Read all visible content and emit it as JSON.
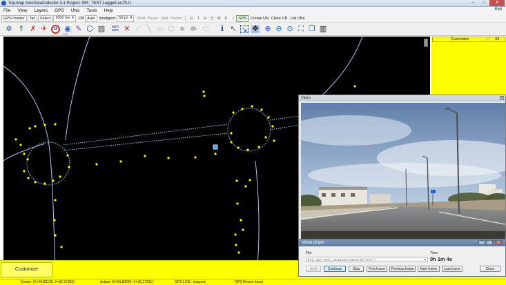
{
  "window": {
    "title": "Top-Map GeoDataCollector 3.1   Project: ISR_TEST  Logged as:PLU",
    "minimize": "–",
    "maximize": "□",
    "close": "✕"
  },
  "menu": {
    "items": [
      "File",
      "View",
      "Layers",
      "GPS",
      "UNs",
      "Tools",
      "Help"
    ],
    "exit_label": "Exit"
  },
  "toolbar": {
    "gps_pointer": "GPS Pointer",
    "tail": "Tail",
    "select": "Select",
    "interval": "1000 ms",
    "off": "Off",
    "auto": "Auto",
    "intelligent_label": "Intelligent",
    "intelligent_value": "50 px",
    "start": "Start",
    "pause": "Pause",
    "add": "Add",
    "delete": "Delete",
    "letters": [
      "G",
      "T",
      "H",
      "O",
      "M",
      "P",
      "I"
    ],
    "gps": "GPS",
    "create_un": "Create UN",
    "close_un": "Close UN",
    "list_uns": "List UNs"
  },
  "icons": {
    "poi_label": "POI",
    "geo_gps_label": "GEO\nGPS"
  },
  "right_panel": {
    "customize": "Customize",
    "all": "All"
  },
  "bottom": {
    "customize": "Customize"
  },
  "status": {
    "center": "Center: (X=34,83130, Y=32,17383)",
    "actual": "Actual: (X=34,83234, Y=32,17331)",
    "gps_log": "GPS LOG : stopped",
    "gps_device": "GPS Device found"
  },
  "video": {
    "title": "Video",
    "close": "×"
  },
  "video_player": {
    "title": "Video player",
    "file_label": "File:",
    "time_label": "Time:",
    "file_value": "PLU_ISR_TEST_20101209-134159.avi  ( 8'44'' )",
    "time_value": "0h 1m 4s",
    "buttons": {
      "start": "Start",
      "continue": "Continue",
      "stop": "Stop",
      "first_frame": "First frame",
      "previous_frame": "Previous frame",
      "next_frame": "Next frame",
      "last_frame": "Last frame",
      "close": "Close"
    }
  },
  "colors": {
    "map_background": "#000000",
    "panel_yellow": "#ffff00",
    "map_point": "#ffff00",
    "map_line": "#a7c9f0"
  }
}
